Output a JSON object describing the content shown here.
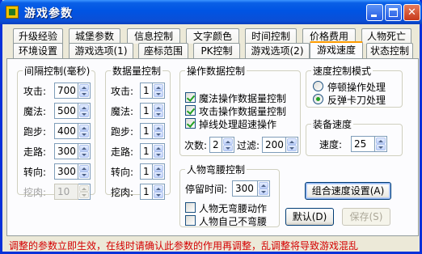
{
  "window": {
    "title": "游戏参数"
  },
  "tabs_row1": [
    "升级经验",
    "城堡参数",
    "信息控制",
    "文字颜色",
    "时间控制",
    "价格费用",
    "人物死亡"
  ],
  "tabs_row2": [
    "环境设置",
    "游戏选项(1)",
    "座标范围",
    "PK控制",
    "游戏选项(2)",
    "游戏速度",
    "状态控制"
  ],
  "active_tab": "游戏速度",
  "interval_group": {
    "title": "间隔控制(毫秒)",
    "rows": [
      {
        "label": "攻击:",
        "value": "700"
      },
      {
        "label": "魔法:",
        "value": "500"
      },
      {
        "label": "跑步:",
        "value": "400"
      },
      {
        "label": "走路:",
        "value": "300"
      },
      {
        "label": "转向:",
        "value": "300"
      },
      {
        "label": "挖肉:",
        "value": "10"
      }
    ]
  },
  "count_group": {
    "title": "数据量控制",
    "rows": [
      {
        "label": "攻击:",
        "value": "1"
      },
      {
        "label": "魔法:",
        "value": "1"
      },
      {
        "label": "跑步:",
        "value": "1"
      },
      {
        "label": "走路:",
        "value": "1"
      },
      {
        "label": "转向:",
        "value": "1"
      },
      {
        "label": "挖肉:",
        "value": "1"
      }
    ]
  },
  "op_group": {
    "title": "操作数据控制",
    "checks": [
      {
        "label": "魔法操作数据量控制",
        "checked": true
      },
      {
        "label": "攻击操作数据量控制",
        "checked": true
      },
      {
        "label": "掉线处理超速操作",
        "checked": true
      }
    ],
    "times_label": "次数:",
    "times_value": "2",
    "filter_label": "过滤:",
    "filter_value": "200"
  },
  "bend_group": {
    "title": "人物弯腰控制",
    "stay_label": "停留时间:",
    "stay_value": "300",
    "checks": [
      {
        "label": "人物无弯腰动作",
        "checked": false
      },
      {
        "label": "人物自己不弯腰",
        "checked": false
      }
    ]
  },
  "speed_mode_group": {
    "title": "速度控制模式",
    "options": [
      {
        "label": "停顿操作处理",
        "selected": false
      },
      {
        "label": "反弹卡刀处理",
        "selected": true
      }
    ]
  },
  "equip_group": {
    "title": "装备速度",
    "speed_label": "速度:",
    "speed_value": "25"
  },
  "buttons": {
    "combo_speed": "组合速度设置(A)",
    "default": "默认(D)",
    "save": "保存(S)"
  },
  "status_text": "调整的参数立即生效，在线时请确认此参数的作用再调整，乱调整将导致游戏混乱"
}
